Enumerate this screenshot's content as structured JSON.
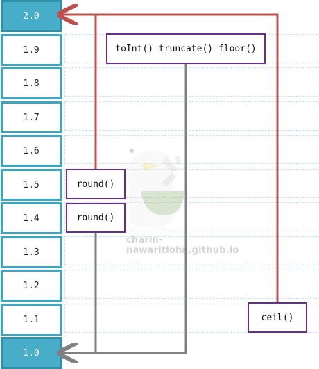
{
  "scale": {
    "values": [
      "2.0",
      "1.9",
      "1.8",
      "1.7",
      "1.6",
      "1.5",
      "1.4",
      "1.3",
      "1.2",
      "1.1",
      "1.0"
    ],
    "highlighted": [
      "2.0",
      "1.0"
    ]
  },
  "functions": {
    "truncating": "toInt() truncate() floor()",
    "round_up": "round()",
    "round_down": "round()",
    "ceil": "ceil()"
  },
  "watermark": {
    "text": "charin-nawaritloha.github.io"
  },
  "colors": {
    "cell_border": "#3aa7c2",
    "cell_highlight": "#47adc8",
    "function_border": "#6a2c91",
    "arrow_up": "#c0504d",
    "arrow_down": "#808080"
  }
}
